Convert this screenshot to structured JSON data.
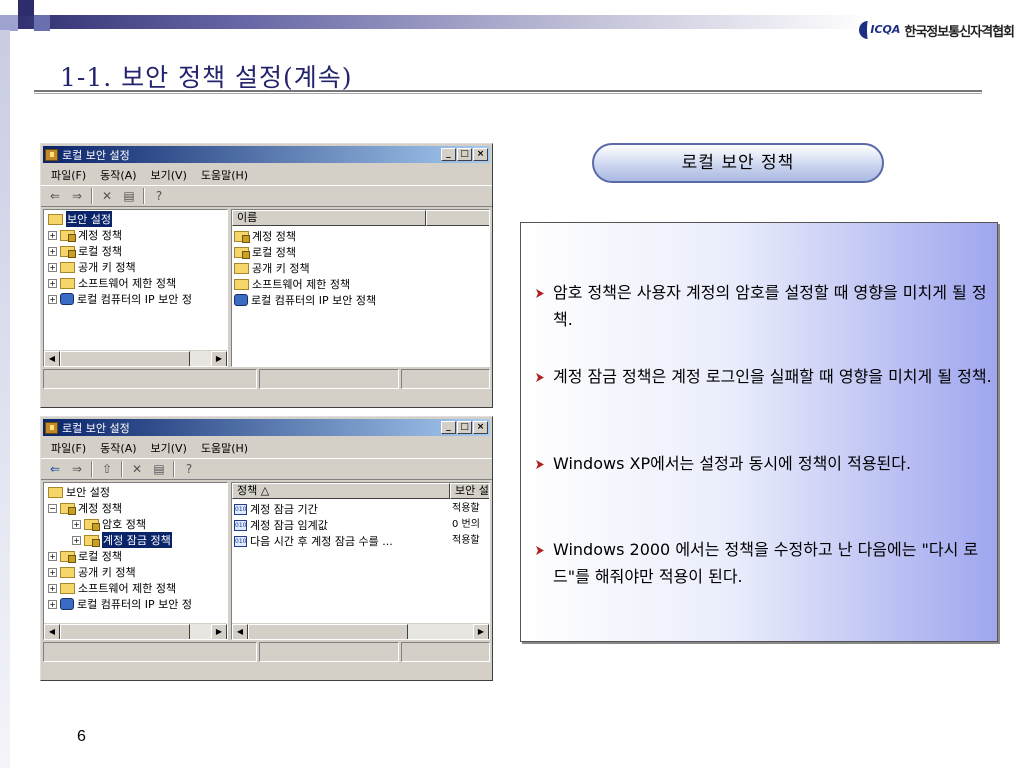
{
  "slide": {
    "title": "1-1. 보안 정책 설정(계속)",
    "page_number": "6",
    "logo_mark": "ICQA",
    "logo_name": "한국정보통신자격협회"
  },
  "window1": {
    "title": "로컬 보안 설정",
    "menu": [
      "파일(F)",
      "동작(A)",
      "보기(V)",
      "도움말(H)"
    ],
    "tree": [
      {
        "label": "보안 설정",
        "selected": true
      },
      {
        "label": "계정 정책"
      },
      {
        "label": "로컬 정책"
      },
      {
        "label": "공개 키 정책"
      },
      {
        "label": "소프트웨어 제한 정책"
      },
      {
        "label": "로컬 컴퓨터의 IP 보안 정"
      }
    ],
    "list_header": "이름",
    "list_items": [
      "계정 정책",
      "로컬 정책",
      "공개 키 정책",
      "소프트웨어 제한 정책",
      "로컬 컴퓨터의 IP 보안 정책"
    ]
  },
  "window2": {
    "title": "로컬 보안 설정",
    "menu": [
      "파일(F)",
      "동작(A)",
      "보기(V)",
      "도움말(H)"
    ],
    "tree": [
      {
        "label": "보안 설정"
      },
      {
        "label": "계정 정책"
      },
      {
        "label": "암호 정책"
      },
      {
        "label": "계정 잠금 정책",
        "selected": true
      },
      {
        "label": "로컬 정책"
      },
      {
        "label": "공개 키 정책"
      },
      {
        "label": "소프트웨어 제한 정책"
      },
      {
        "label": "로컬 컴퓨터의 IP 보안 정"
      }
    ],
    "list_headers": [
      "정책 △",
      "보안 설"
    ],
    "rows": [
      {
        "policy": "계정 잠금 기간",
        "setting": "적용할"
      },
      {
        "policy": "계정 잠금 임계값",
        "setting": "0 번의"
      },
      {
        "policy": "다음 시간 후 계정 잠금 수를 ...",
        "setting": "적용할"
      }
    ]
  },
  "panel": {
    "heading": "로컬 보안 정책",
    "bullets": [
      "암호 정책은 사용자 계정의 암호를 설정할 때 영향을 미치게 될 정책.",
      "계정 잠금 정책은 계정 로그인을 실패할 때 영향을 미치게 될 정책.",
      "Windows XP에서는 설정과 동시에 정책이 적용된다.",
      "Windows 2000 에서는 정책을 수정하고 난 다음에는 \"다시 로드\"를 해줘야만 적용이 된다."
    ]
  }
}
